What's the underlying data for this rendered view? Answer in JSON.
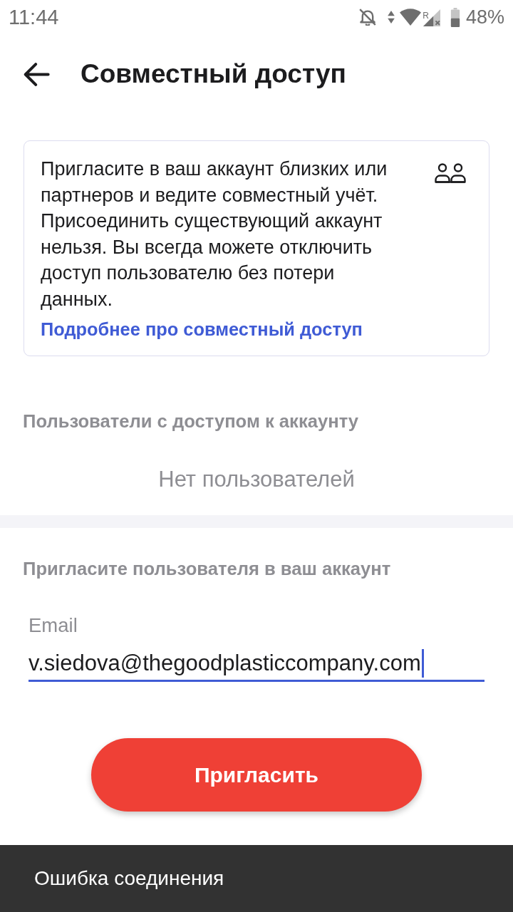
{
  "status_bar": {
    "time": "11:44",
    "roaming": "R",
    "battery": "48%"
  },
  "header": {
    "title": "Совместный доступ"
  },
  "info_card": {
    "text": "Пригласите в ваш аккаунт близких или партнеров и ведите совместный учёт. Присоединить существующий аккаунт нельзя. Вы всегда можете отключить доступ пользователю без потери данных.",
    "link": "Подробнее про совместный доступ"
  },
  "users_section": {
    "heading": "Пользователи с доступом к аккаунту",
    "empty_text": "Нет пользователей"
  },
  "invite_section": {
    "heading": "Пригласите пользователя в ваш аккаунт",
    "email_field": {
      "label": "Email",
      "value": "v.siedova@thegoodplasticcompany.com",
      "focused": true
    }
  },
  "invite_button": {
    "label": "Пригласить"
  },
  "snackbar": {
    "message": "Ошибка соединения"
  }
}
